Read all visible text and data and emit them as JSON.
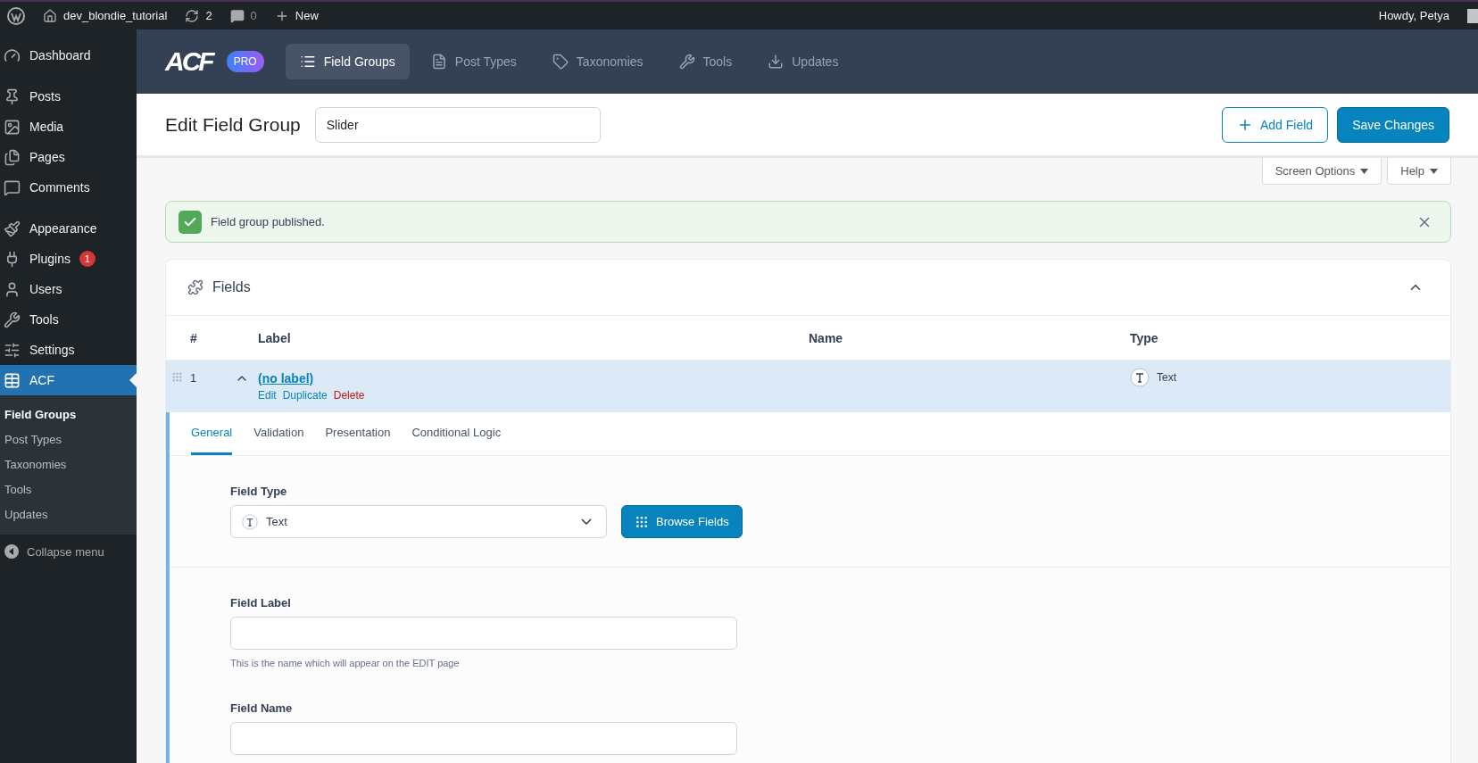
{
  "admin_bar": {
    "site_name": "dev_blondie_tutorial",
    "updates_count": "2",
    "comments_count": "0",
    "new_label": "New",
    "greeting": "Howdy, Petya"
  },
  "sidebar": {
    "groups": [
      [
        {
          "label": "Dashboard",
          "selected": false
        }
      ],
      [
        {
          "label": "Posts",
          "selected": false
        },
        {
          "label": "Media",
          "selected": false
        },
        {
          "label": "Pages",
          "selected": false
        },
        {
          "label": "Comments",
          "selected": false
        }
      ],
      [
        {
          "label": "Appearance",
          "selected": false
        },
        {
          "label": "Plugins",
          "selected": false,
          "badge": "1"
        },
        {
          "label": "Users",
          "selected": false
        },
        {
          "label": "Tools",
          "selected": false
        },
        {
          "label": "Settings",
          "selected": false
        },
        {
          "label": "ACF",
          "selected": true
        }
      ]
    ],
    "submenu": [
      {
        "label": "Field Groups",
        "selected": true
      },
      {
        "label": "Post Types",
        "selected": false
      },
      {
        "label": "Taxonomies",
        "selected": false
      },
      {
        "label": "Tools",
        "selected": false
      },
      {
        "label": "Updates",
        "selected": false
      }
    ],
    "collapse_label": "Collapse menu"
  },
  "acf_nav": {
    "logo": "ACF",
    "badge": "PRO",
    "tabs": [
      {
        "label": "Field Groups",
        "selected": true
      },
      {
        "label": "Post Types",
        "selected": false
      },
      {
        "label": "Taxonomies",
        "selected": false
      },
      {
        "label": "Tools",
        "selected": false
      },
      {
        "label": "Updates",
        "selected": false
      }
    ]
  },
  "title_bar": {
    "title": "Edit Field Group",
    "group_name": "Slider",
    "add_button": "Add Field",
    "save_button": "Save Changes"
  },
  "screen_meta": [
    "Screen Options",
    "Help"
  ],
  "notice": {
    "message": "Field group published."
  },
  "fields_panel": {
    "title": "Fields",
    "columns": [
      "#",
      "Label",
      "Name",
      "Type"
    ],
    "rows": [
      {
        "number": "1",
        "label": "(no label)",
        "actions": [
          "Edit",
          "Duplicate",
          "Delete"
        ],
        "type": "Text",
        "selected": true,
        "expanded": true
      }
    ],
    "settings_tabs": [
      {
        "label": "General",
        "selected": true
      },
      {
        "label": "Validation",
        "selected": false
      },
      {
        "label": "Presentation",
        "selected": false
      },
      {
        "label": "Conditional Logic",
        "selected": false
      }
    ],
    "field_type": {
      "label": "Field Type",
      "value": "Text",
      "browse_button": "Browse Fields"
    },
    "field_label": {
      "label": "Field Label",
      "instructions": "This is the name which will appear on the EDIT page"
    },
    "field_name": {
      "label": "Field Name"
    }
  }
}
